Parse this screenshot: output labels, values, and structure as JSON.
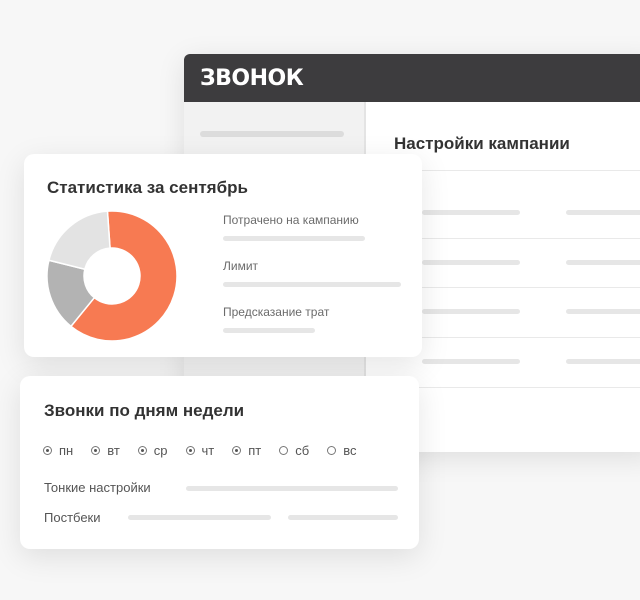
{
  "app": {
    "logo": "ЗВОНОК"
  },
  "window": {
    "panel_title": "Настройки кампании"
  },
  "stats_card": {
    "title": "Статистика за сентябрь",
    "labels": [
      "Потрачено на кампанию",
      "Лимит",
      "Предсказание трат"
    ],
    "donut": {
      "segments": [
        {
          "share": 0.62,
          "color": "#f77a52"
        },
        {
          "share": 0.18,
          "color": "#b3b3b3"
        },
        {
          "share": 0.2,
          "color": "#e3e3e3"
        }
      ]
    }
  },
  "calls_card": {
    "title": "Звонки по дням недели",
    "days": [
      {
        "label": "пн",
        "checked": true
      },
      {
        "label": "вт",
        "checked": true
      },
      {
        "label": "ср",
        "checked": true
      },
      {
        "label": "чт",
        "checked": true
      },
      {
        "label": "пт",
        "checked": true
      },
      {
        "label": "сб",
        "checked": false
      },
      {
        "label": "вс",
        "checked": false
      }
    ],
    "fine_tuning_label": "Тонкие настройки",
    "postbacks_label": "Постбеки"
  },
  "colors": {
    "accent": "#f77a52",
    "header": "#3d3c3e"
  }
}
